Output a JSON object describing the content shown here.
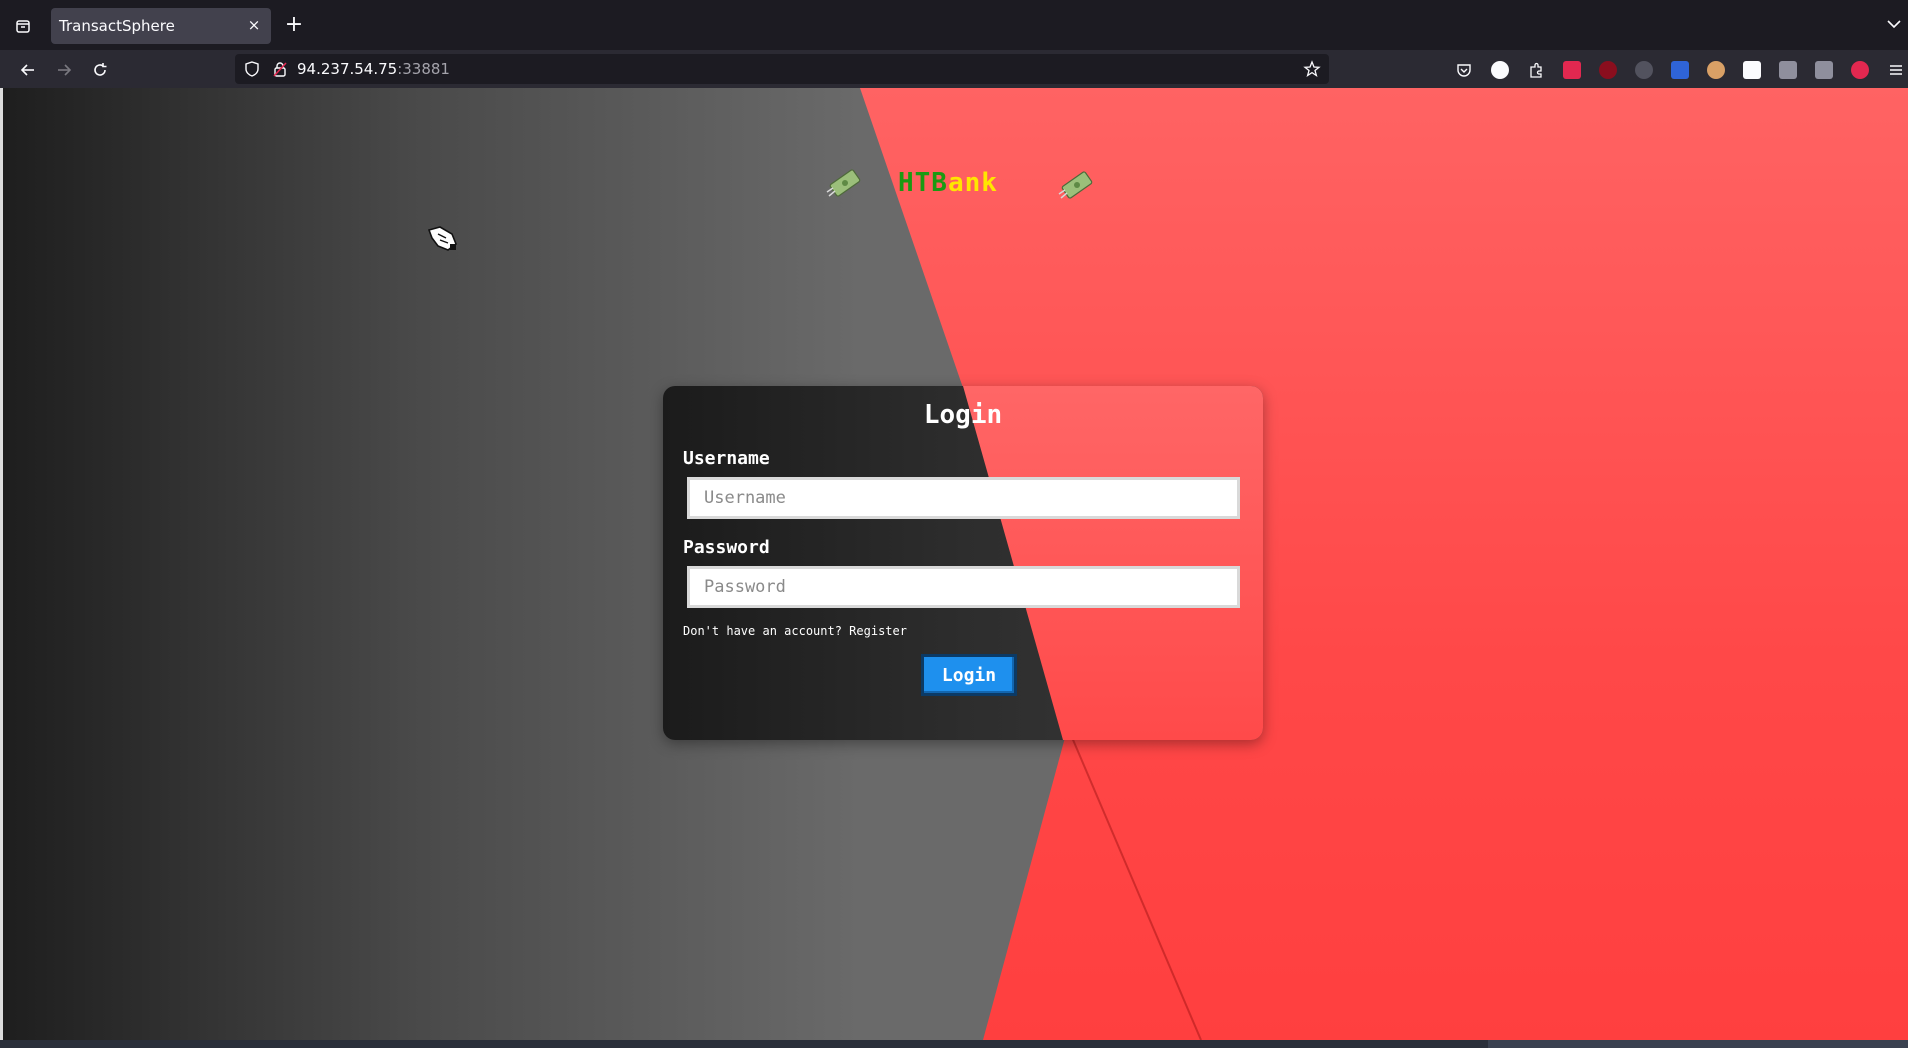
{
  "browser": {
    "tab_title": "TransactSphere",
    "tab_close": "×",
    "new_tab": "+",
    "url_host": "94.237.54.75",
    "url_port": ":33881"
  },
  "page": {
    "brand_part1": "HTB",
    "brand_part2": "ank",
    "card_title": "Login",
    "username_label": "Username",
    "username_placeholder": "Username",
    "username_value": "",
    "password_label": "Password",
    "password_placeholder": "Password",
    "password_value": "",
    "register_prompt": "Don't have an account? ",
    "register_link": "Register",
    "login_button": "Login"
  },
  "colors": {
    "brand_green": "#1a9a12",
    "brand_yellow": "#ffe600",
    "accent_red": "#ff4848",
    "button_blue": "#1e90ee"
  },
  "icons": [
    "tab-list-icon",
    "back-icon",
    "forward-icon",
    "reload-icon",
    "shield-icon",
    "lock-icon",
    "bookmark-star-icon",
    "pocket-icon",
    "extension-icon",
    "menu-icon",
    "money-icon",
    "pointer-cursor-icon"
  ]
}
